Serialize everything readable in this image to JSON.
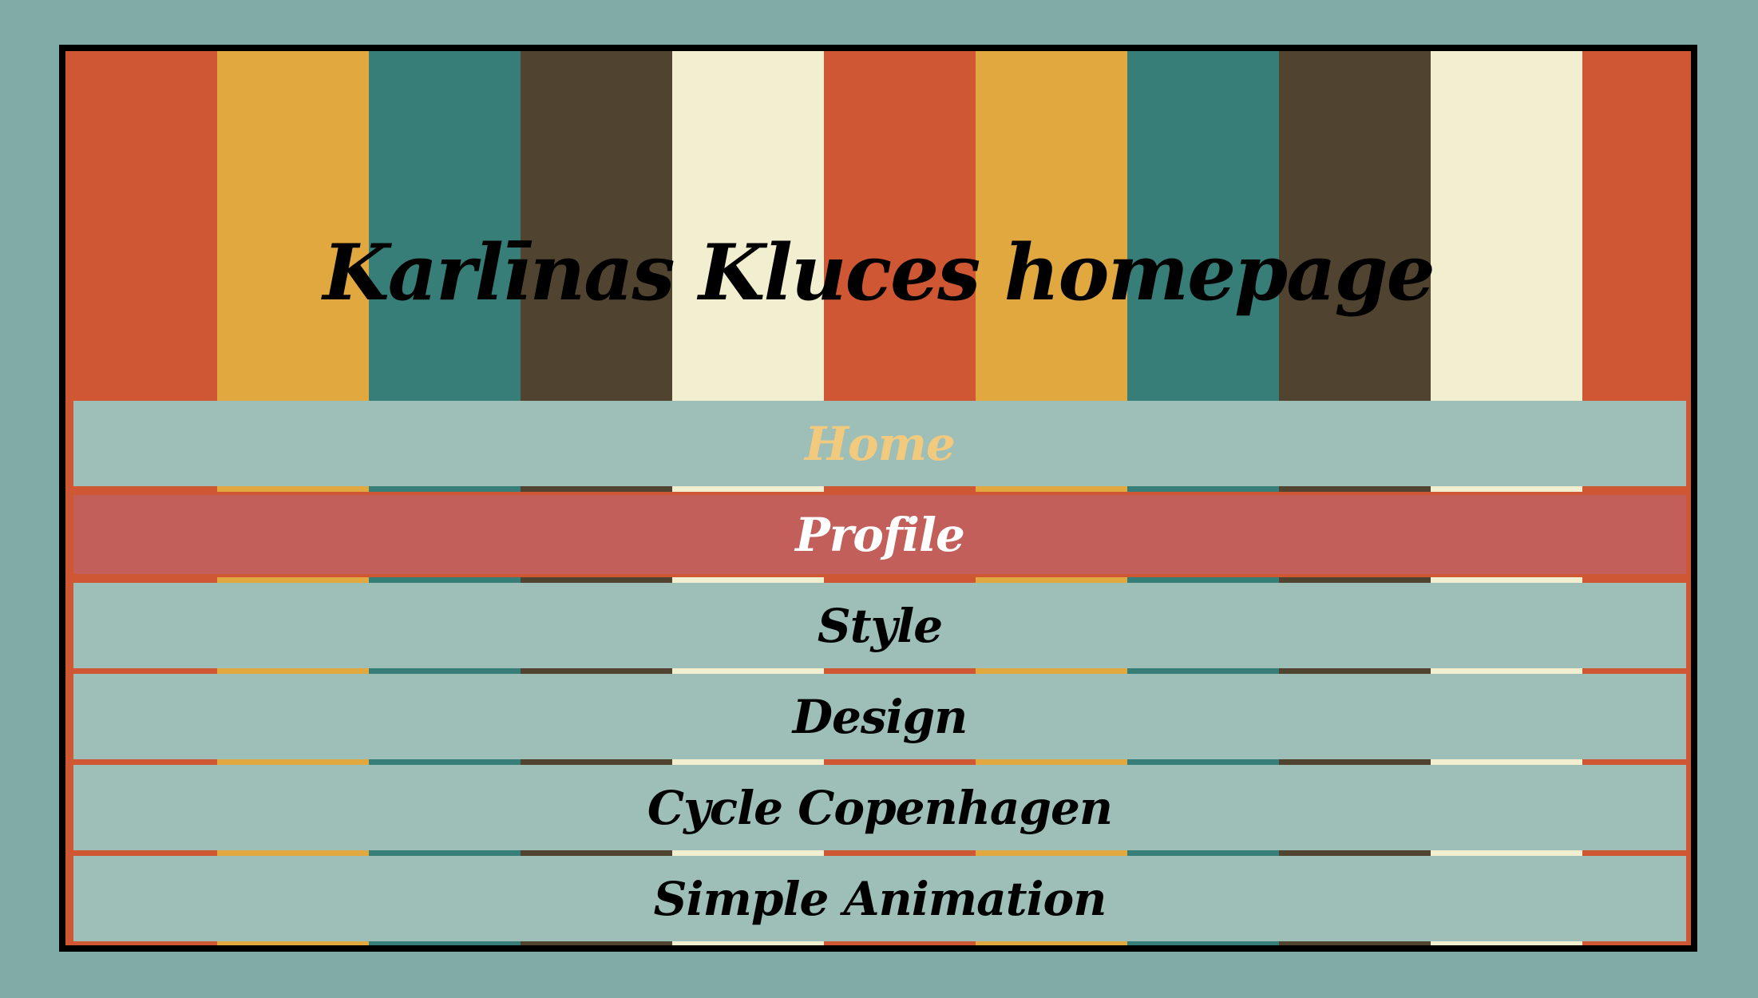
{
  "page": {
    "title": "Karlīnas Kluces homepage"
  },
  "nav": {
    "items": [
      {
        "label": "Home"
      },
      {
        "label": "Profile"
      },
      {
        "label": "Style"
      },
      {
        "label": "Design"
      },
      {
        "label": "Cycle Copenhagen"
      },
      {
        "label": "Simple Animation"
      }
    ]
  },
  "colors": {
    "page_background": "#81aba6",
    "stripe_orange": "#cf5733",
    "stripe_yellow": "#e1a840",
    "stripe_teal": "#377e79",
    "stripe_brown": "#504431",
    "stripe_cream": "#f2efd0",
    "nav_background": "#9ebeb8",
    "nav_hover_background": "#c25f5b",
    "nav_current_text": "#f1ca7e",
    "nav_hover_text": "#ffffff",
    "text": "#000000"
  }
}
